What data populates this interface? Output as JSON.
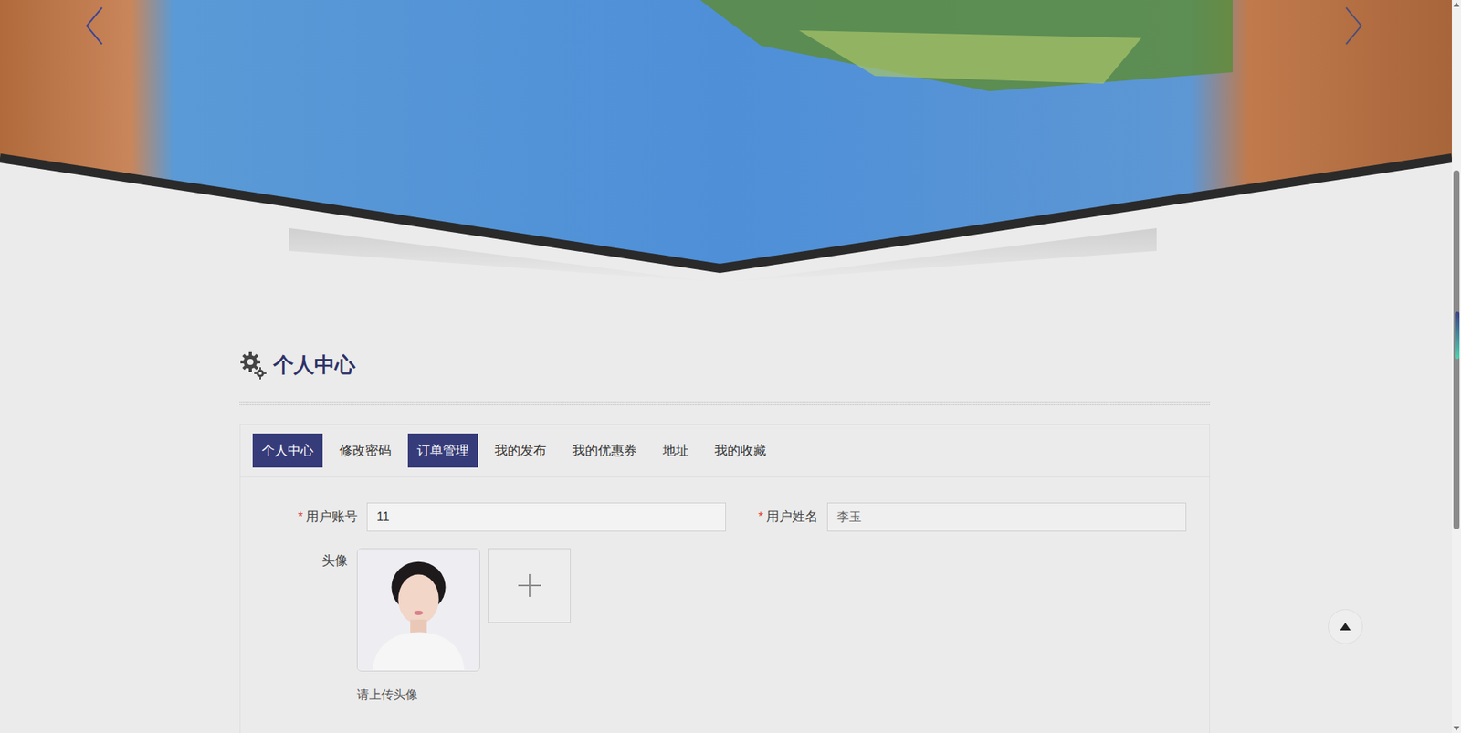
{
  "heading": "个人中心",
  "tabs": [
    {
      "label": "个人中心",
      "selected": true,
      "highlighted": false
    },
    {
      "label": "修改密码",
      "selected": false,
      "highlighted": false
    },
    {
      "label": "订单管理",
      "selected": false,
      "highlighted": true
    },
    {
      "label": "我的发布",
      "selected": false,
      "highlighted": false
    },
    {
      "label": "我的优惠券",
      "selected": false,
      "highlighted": false
    },
    {
      "label": "地址",
      "selected": false,
      "highlighted": false
    },
    {
      "label": "我的收藏",
      "selected": false,
      "highlighted": false
    }
  ],
  "required_mark": "*",
  "form": {
    "fields": [
      {
        "label": "用户账号",
        "required": true,
        "value": "11",
        "disabled": false
      },
      {
        "label": "用户姓名",
        "required": true,
        "value": "李玉",
        "disabled": true
      }
    ],
    "avatar": {
      "label": "头像",
      "hint": "请上传头像"
    }
  }
}
